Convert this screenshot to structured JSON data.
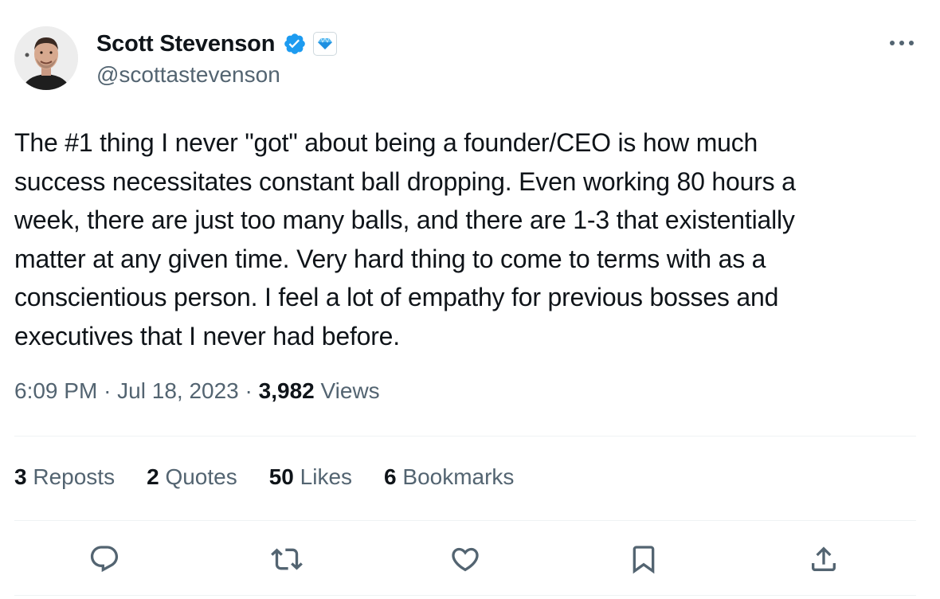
{
  "author": {
    "display_name": "Scott Stevenson",
    "handle": "@scottastevenson",
    "verified_color": "#1d9bf0"
  },
  "tweet": {
    "lines": [
      "The #1 thing I never \"got\" about being a founder/CEO is how much",
      "success necessitates constant ball dropping. Even working 80 hours a",
      "week, there are just too many balls, and there are 1-3 that existentially",
      "matter at any given time. Very hard thing to come to terms with as a",
      "conscientious person. I feel a lot of empathy for previous bosses and",
      "executives that I never had before."
    ],
    "time": "6:09 PM",
    "date": "Jul 18, 2023",
    "views_count": "3,982",
    "views_label": "Views"
  },
  "stats": {
    "reposts": {
      "count": "3",
      "label": "Reposts"
    },
    "quotes": {
      "count": "2",
      "label": "Quotes"
    },
    "likes": {
      "count": "50",
      "label": "Likes"
    },
    "bookmarks": {
      "count": "6",
      "label": "Bookmarks"
    }
  },
  "icons": {
    "reply": "reply-icon",
    "repost": "repost-icon",
    "like": "like-icon",
    "bookmark": "bookmark-icon",
    "share": "share-icon",
    "more": "more-icon"
  }
}
